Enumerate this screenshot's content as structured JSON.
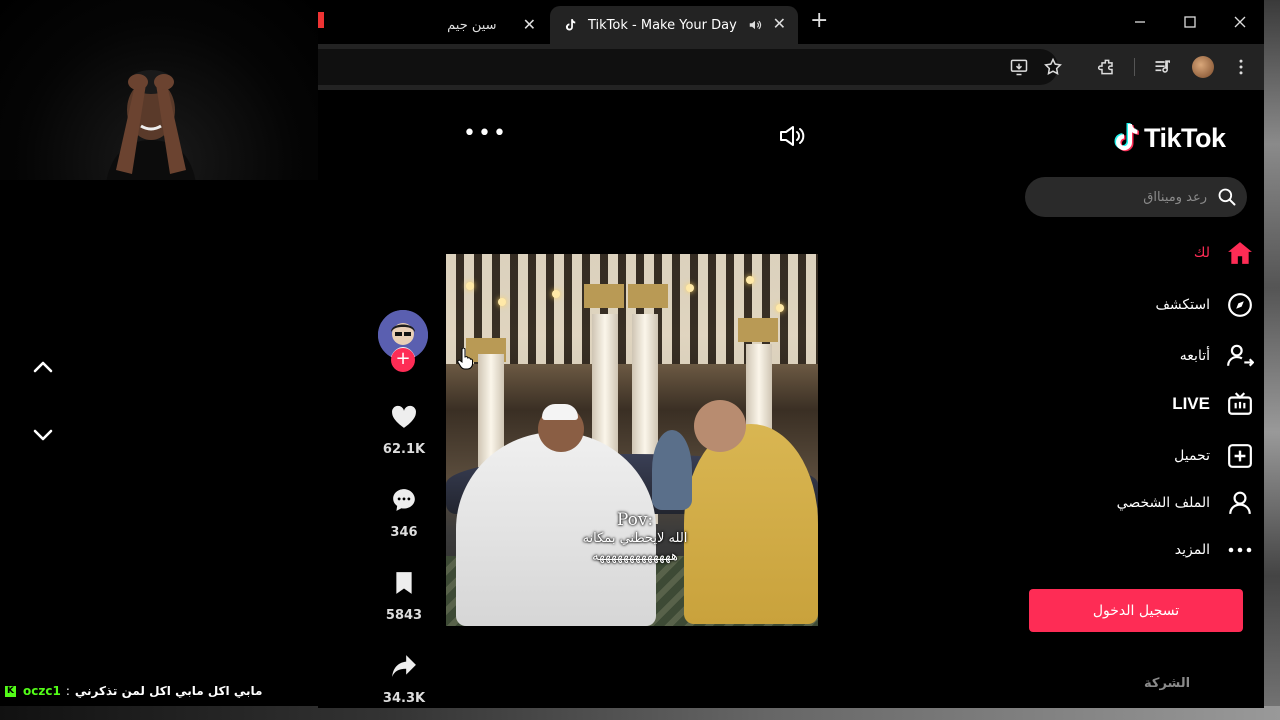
{
  "browser": {
    "tabs": [
      {
        "title": "سين جيم",
        "active": false
      },
      {
        "title": "TikTok - Make Your Day",
        "active": true
      }
    ],
    "new_tab_label": "+"
  },
  "tiktok": {
    "logo_text": "TikTok",
    "search": {
      "placeholder": "رعد ومينااق"
    },
    "nav": [
      {
        "label": "لك",
        "icon": "home-icon",
        "active": true
      },
      {
        "label": "استكشف",
        "icon": "compass-icon"
      },
      {
        "label": "أتابعه",
        "icon": "following-icon"
      },
      {
        "label": "LIVE",
        "icon": "live-tv-icon"
      },
      {
        "label": "تحميل",
        "icon": "upload-icon"
      },
      {
        "label": "الملف الشخصي",
        "icon": "profile-icon"
      },
      {
        "label": "المزيد",
        "icon": "more-icon"
      }
    ],
    "login_label": "تسجيل الدخول",
    "company_label": "الشركة",
    "video": {
      "caption_pov": "Pov:",
      "caption_line1": "الله لايحطني بمكانه",
      "caption_line2": "هههههههههههههه"
    },
    "actions": {
      "likes": "62.1K",
      "comments": "346",
      "saves": "5843",
      "shares": "34.3K"
    },
    "colors": {
      "accent": "#fe2c55",
      "teal": "#25f4ee"
    }
  },
  "stream": {
    "chat": {
      "badge": "K",
      "username": "oczc1",
      "separator": ":",
      "message": "مابي اكل مابي اكل لمن تذكرني"
    }
  }
}
